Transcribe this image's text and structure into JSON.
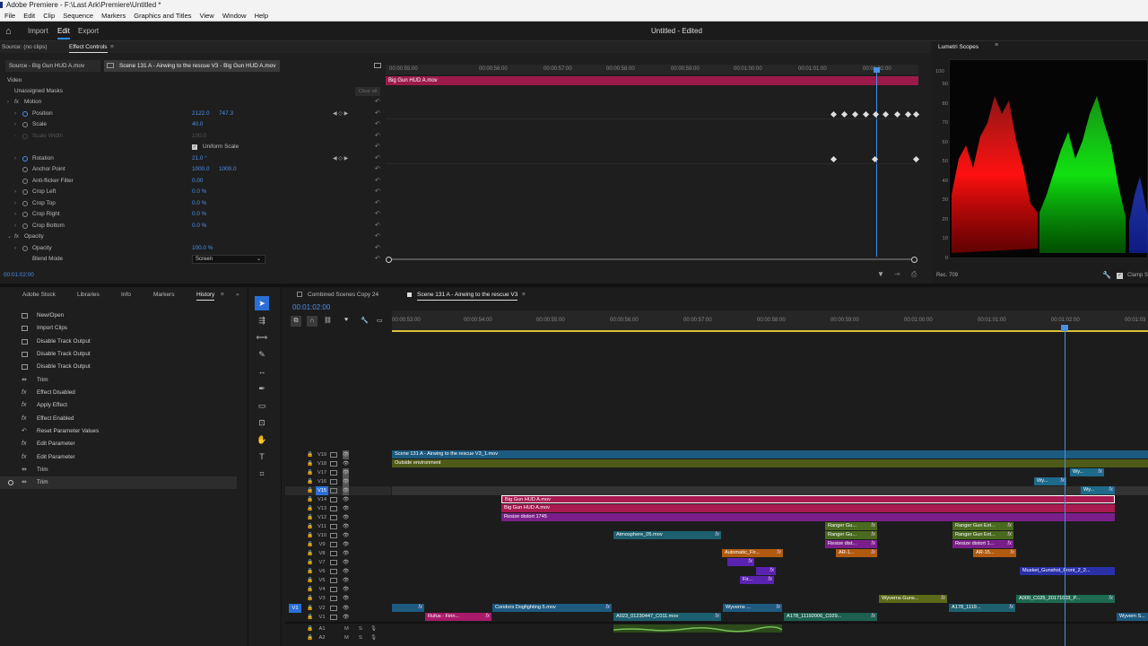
{
  "window": {
    "title": "Adobe Premiere - F:\\Last Ark\\Premiere\\Untitled *"
  },
  "menu": [
    "File",
    "Edit",
    "Clip",
    "Sequence",
    "Markers",
    "Graphics and Titles",
    "View",
    "Window",
    "Help"
  ],
  "workspaces": {
    "import": "Import",
    "edit": "Edit",
    "export": "Export"
  },
  "project_title": "Untitled - Edited",
  "effect_controls": {
    "source_tab": "Source: (no clips)",
    "ec_tab": "Effect Controls",
    "clip_source": "Source - Big Gun HUD A.mov",
    "clip_sequence": "Scene 131 A - Airwing to the rescue V3 - Big Gun HUD A.mov",
    "clip_bar_label": "Big Gun HUD A.mov",
    "ruler": [
      "00:00:55:00",
      "00:00:56:00",
      "00:00:57:00",
      "00:00:58:00",
      "00:00:59:00",
      "00:01:00:00",
      "00:01:01:00",
      "00:01:02:00"
    ],
    "clear_all": "Clear all",
    "current_time": "00:01:02:00",
    "rows": {
      "video": "Video",
      "masks": "Unassigned Masks",
      "motion": "Motion",
      "position": "Position",
      "position_x": "2122.0",
      "position_y": "747.3",
      "scale": "Scale",
      "scale_val": "40.0",
      "scale_width": "Scale Width",
      "scale_width_val": "100.0",
      "uniform": "Uniform Scale",
      "rotation": "Rotation",
      "rotation_val": "21.0 °",
      "anchor": "Anchor Point",
      "anchor_x": "1000.0",
      "anchor_y": "1000.0",
      "antiflicker": "Anti-flicker Filter",
      "antiflicker_val": "0.00",
      "crop_left": "Crop Left",
      "crop_left_val": "0.0 %",
      "crop_top": "Crop Top",
      "crop_top_val": "0.0 %",
      "crop_right": "Crop Right",
      "crop_right_val": "0.0 %",
      "crop_bottom": "Crop Bottom",
      "crop_bottom_val": "0.0 %",
      "opacity_group": "Opacity",
      "opacity": "Opacity",
      "opacity_val": "100.0 %",
      "blend": "Blend Mode",
      "blend_val": "Screen"
    }
  },
  "scopes": {
    "title": "Lumetri Scopes",
    "scale": [
      "100",
      "90",
      "80",
      "70",
      "60",
      "50",
      "40",
      "30",
      "20",
      "10",
      "0"
    ],
    "standard": "Rec. 709",
    "clamp": "Clamp S"
  },
  "left_tabs": [
    "Adobe Stock",
    "Libraries",
    "Info",
    "Markers",
    "History"
  ],
  "history": [
    "New/Open",
    "Import Clips",
    "Disable Track Output",
    "Disable Track Output",
    "Disable Track Output",
    "Trim",
    "Effect Disabled",
    "Apply Effect",
    "Effect Enabled",
    "Reset Parameter Values",
    "Edit Parameter",
    "Edit Parameter",
    "Trim",
    "Trim"
  ],
  "timeline": {
    "tab1": "Combined Scenes Copy 24",
    "tab2": "Scene 131 A - Airwing to the rescue V3",
    "timecode": "00:01:02:00",
    "ruler": [
      "00:00:53:00",
      "00:00:54:00",
      "00:00:55:00",
      "00:00:56:00",
      "00:00:57:00",
      "00:00:58:00",
      "00:00:59:00",
      "00:01:00:00",
      "00:01:01:00",
      "00:01:02:00",
      "00:01:03"
    ],
    "tracks": [
      "V19",
      "V18",
      "V17",
      "V16",
      "V15",
      "V14",
      "V13",
      "V12",
      "V11",
      "V10",
      "V9",
      "V8",
      "V7",
      "V6",
      "V5",
      "V4",
      "V3",
      "V2",
      "V1",
      "A1",
      "A2"
    ],
    "source_patch": "V1",
    "clips": {
      "c1": "Scene 131 A - Airwing to the rescue V3_1.mov",
      "c2": "Outside environment",
      "c3": "Wy...",
      "c4": "Wy...",
      "c5": "Wy...",
      "c6": "Big Gun HUD A.mov",
      "c7": "Big Gun HUD A.mov",
      "c8": "Resize distort 1745",
      "c9": "Ranger Gu...",
      "c10": "Ranger Gun Ext...",
      "c11": "Atmosphere_05.mov",
      "c12": "Ranger Gu...",
      "c13": "Ranger Gun Ext...",
      "c14": "Resize dist...",
      "c15": "Resize distort 1...",
      "c16": "Automatic_Fir...",
      "c17": "AR-1...",
      "c18": "AR-15...",
      "c19": "Musket_Gunshot_Front_2_2...",
      "c20": "Fir...",
      "c21": "Wyverns Guns...",
      "c22": "A000_C025_20171003_P...",
      "c23": "Condors Dogfighting 5.mov",
      "c24": "Wyverns ...",
      "c25": "A178_1119...",
      "c26": "Rufus - Firin...",
      "c27": "A023_01230447_C011.mov",
      "c28": "A178_11192006_C029...",
      "c29": "Wyvern S..."
    },
    "fx": "fx",
    "m": "M",
    "s": "S"
  }
}
